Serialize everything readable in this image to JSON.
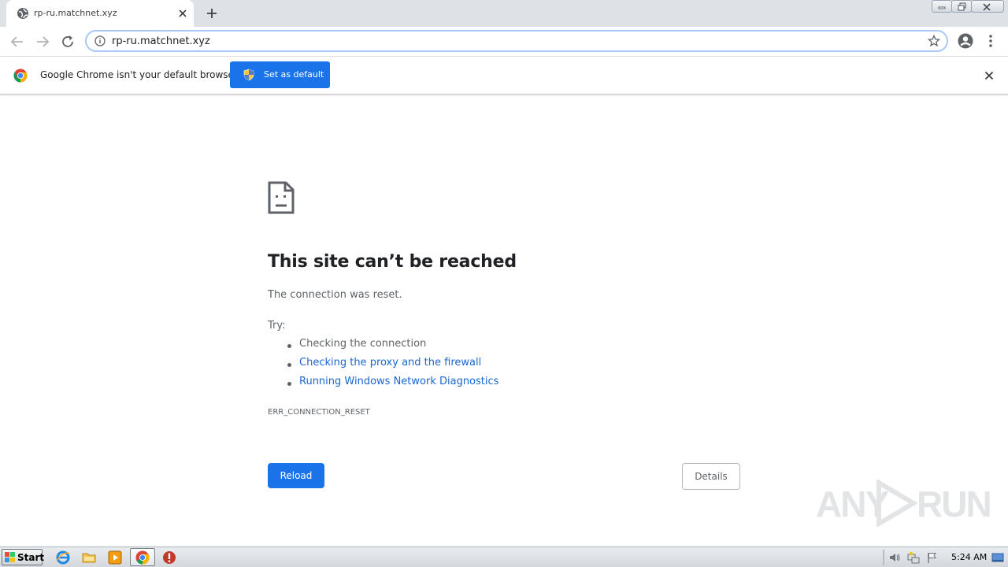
{
  "browser": {
    "tab_title": "rp-ru.matchnet.xyz",
    "address": "rp-ru.matchnet.xyz"
  },
  "infobar": {
    "message": "Google Chrome isn't your default browser",
    "set_default_label": "Set as default"
  },
  "error_page": {
    "title": "This site can’t be reached",
    "description": "The connection was reset.",
    "try_label": "Try:",
    "suggestions": [
      "Checking the connection",
      "Checking the proxy and the firewall",
      "Running Windows Network Diagnostics"
    ],
    "error_code": "ERR_CONNECTION_RESET",
    "reload_label": "Reload",
    "details_label": "Details"
  },
  "watermark": {
    "left": "ANY",
    "right": "RUN"
  },
  "taskbar": {
    "start_label": "Start",
    "clock": "5:24 AM",
    "pinned_icons": [
      "internet-explorer-icon",
      "folder-icon",
      "media-player-icon",
      "chrome-icon",
      "stop-icon"
    ]
  },
  "colors": {
    "accent": "#1a73e8",
    "link": "#1967d2",
    "tabstrip": "#dee1e6",
    "text_secondary": "#5f6368"
  }
}
